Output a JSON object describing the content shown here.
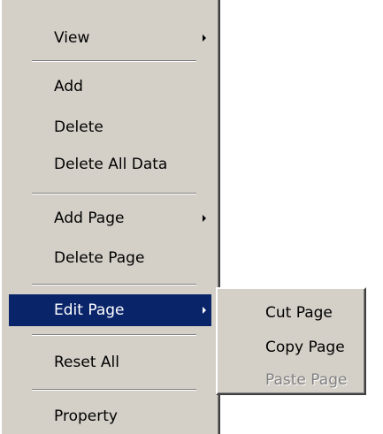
{
  "main_menu": {
    "items": [
      {
        "label": "View",
        "has_submenu": true
      },
      {
        "label": "Add",
        "has_submenu": false
      },
      {
        "label": "Delete",
        "has_submenu": false
      },
      {
        "label": "Delete All Data",
        "has_submenu": false
      },
      {
        "label": "Add Page",
        "has_submenu": true
      },
      {
        "label": "Delete Page",
        "has_submenu": false
      },
      {
        "label": "Edit Page",
        "has_submenu": true,
        "highlighted": true
      },
      {
        "label": "Reset All",
        "has_submenu": false
      },
      {
        "label": "Property",
        "has_submenu": false
      }
    ]
  },
  "sub_menu": {
    "items": [
      {
        "label": "Cut Page",
        "enabled": true
      },
      {
        "label": "Copy Page",
        "enabled": true
      },
      {
        "label": "Paste Page",
        "enabled": false
      }
    ]
  },
  "colors": {
    "menu_background": "#d4d0c8",
    "highlight_background": "#0a246a",
    "highlight_text": "#ffffff",
    "disabled_text": "#808080"
  }
}
